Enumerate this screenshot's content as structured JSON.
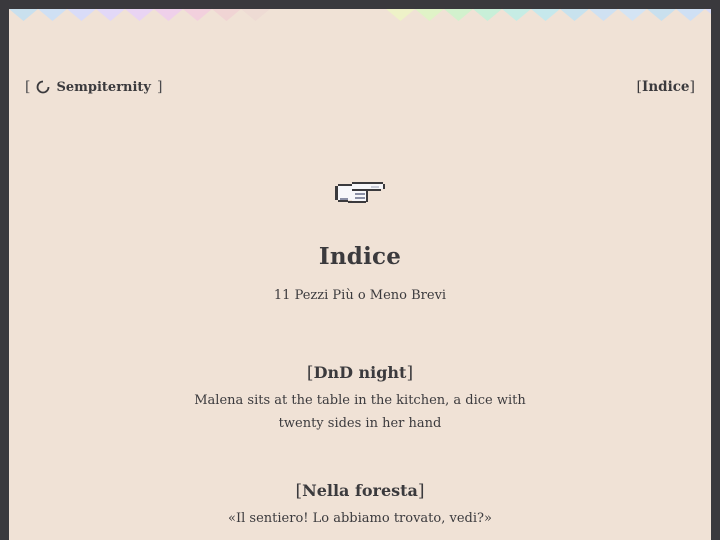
{
  "header": {
    "site_name": "Sempiternity",
    "open_bracket": "[",
    "close_bracket": "]",
    "nav_open": "[",
    "nav_label": "Indice",
    "nav_close": "]"
  },
  "hero": {
    "icon": "pointing-hand-icon",
    "title": "Indice",
    "subtitle": "11 Pezzi Più o Meno Brevi"
  },
  "entries": [
    {
      "open": "[",
      "title": "DnD night",
      "close": "]",
      "description": "Malena sits at the table in the kitchen, a dice with twenty sides in her hand"
    },
    {
      "open": "[",
      "title": "Nella foresta",
      "close": "]",
      "description": "«Il sentiero! Lo abbiamo trovato, vedi?»"
    }
  ],
  "colors": {
    "background": "#f0e2d6",
    "frame": "#3a393d",
    "text": "#3b3a3d"
  }
}
